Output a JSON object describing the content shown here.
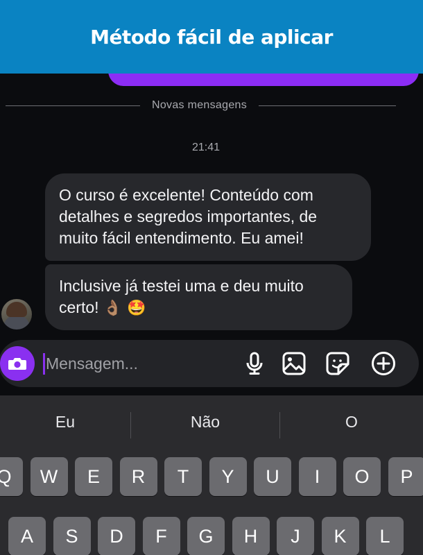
{
  "banner": {
    "title": "Método fácil de aplicar"
  },
  "chat": {
    "divider_label": "Novas mensagens",
    "timestamp": "21:41",
    "messages": [
      {
        "text": "O curso é excelente! Conteúdo com detalhes e segredos importantes, de muito fácil entendimento. Eu amei!"
      },
      {
        "text": "Inclusive já testei uma e deu muito certo!",
        "emojis": "👌🏽 🤩"
      }
    ]
  },
  "composer": {
    "placeholder": "Mensagem...",
    "icons": [
      "camera-icon",
      "microphone-icon",
      "image-icon",
      "sticker-icon",
      "plus-circle-icon"
    ]
  },
  "keyboard": {
    "suggestions": [
      "Eu",
      "Não",
      "O"
    ],
    "row1": [
      "Q",
      "W",
      "E",
      "R",
      "T",
      "Y",
      "U",
      "I",
      "O",
      "P"
    ],
    "row2": [
      "A",
      "S",
      "D",
      "F",
      "G",
      "H",
      "J",
      "K",
      "L"
    ]
  },
  "colors": {
    "banner": "#0a83c2",
    "accent": "#8a30f0",
    "bubble": "#27282c",
    "background": "#0b0c0f"
  }
}
